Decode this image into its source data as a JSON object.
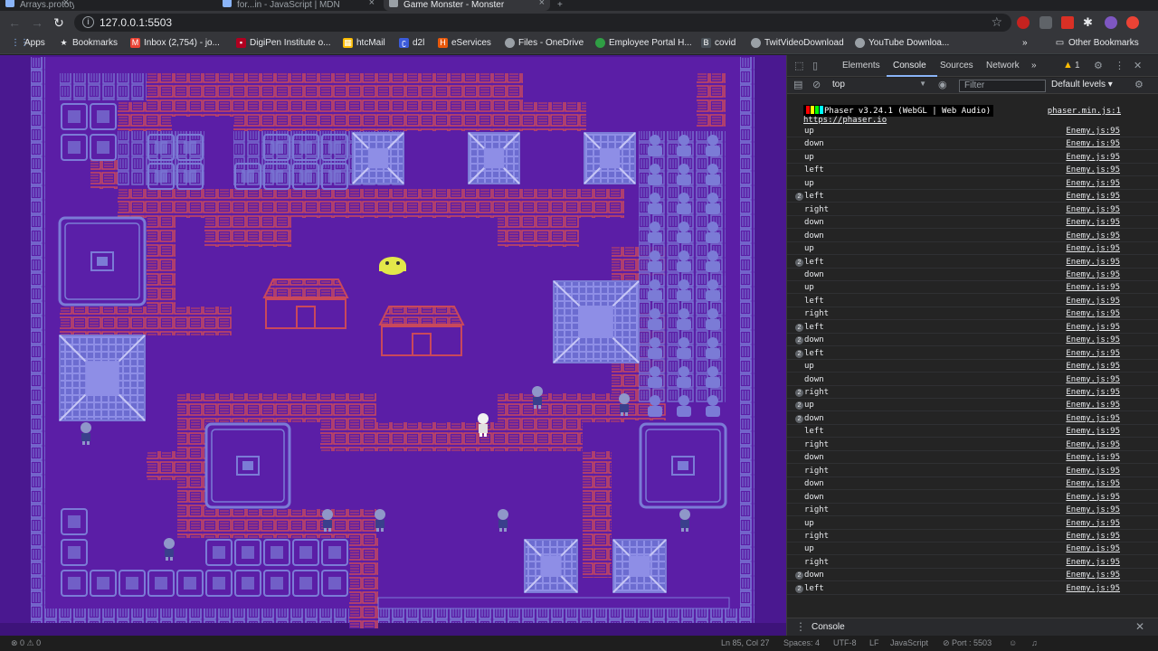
{
  "browser": {
    "tabs": [
      {
        "title": "Arrays.prototype.splice() - JavaScript | MDN"
      },
      {
        "title": "for...in - JavaScript | MDN"
      },
      {
        "title": "Game Monster - Monster"
      }
    ],
    "url": "127.0.0.1:5503",
    "nav": {
      "back": "←",
      "forward": "→",
      "reload": "↻"
    },
    "bookmarks": [
      {
        "label": "Apps",
        "icon": "apps-grid-icon",
        "color": "#8ab4f8"
      },
      {
        "label": "Bookmarks",
        "icon": "star-icon",
        "color": "#e8eaed"
      },
      {
        "label": "Inbox (2,754) - jo...",
        "icon": "gmail-icon",
        "color": "#ea4335"
      },
      {
        "label": "DigiPen Institute o...",
        "icon": "digipen-icon",
        "color": "#b00020"
      },
      {
        "label": "htcMail",
        "icon": "grid-icon",
        "color": "#fbbc04"
      },
      {
        "label": "d2l",
        "icon": "d2l-icon",
        "color": "#3b5bdb"
      },
      {
        "label": "eServices",
        "icon": "eservices-icon",
        "color": "#e8590c"
      },
      {
        "label": "Files - OneDrive",
        "icon": "onedrive-icon",
        "color": "#9aa0a6"
      },
      {
        "label": "Employee Portal H...",
        "icon": "portal-icon",
        "color": "#2f9e44"
      },
      {
        "label": "covid",
        "icon": "doc-icon",
        "color": "#495057"
      },
      {
        "label": "TwitVideoDownload",
        "icon": "globe-icon",
        "color": "#9aa0a6"
      },
      {
        "label": "YouTube Downloa...",
        "icon": "globe-icon",
        "color": "#9aa0a6"
      }
    ],
    "more_bookmarks": "»",
    "other_bookmarks": "Other Bookmarks"
  },
  "devtools": {
    "tabs": [
      "Elements",
      "Console",
      "Sources",
      "Network"
    ],
    "active_tab": "Console",
    "more_tabs": "»",
    "warning_count": "1",
    "context": "top",
    "filter_placeholder": "Filter",
    "levels": "Default levels ▾",
    "phaser_banner": "Phaser v3.24.1 (WebGL | Web Audio)",
    "phaser_url": "https://phaser.io",
    "phaser_source": "phaser.min.js:1",
    "logs": [
      {
        "msg": "up",
        "count": "",
        "src": "Enemy.js:95"
      },
      {
        "msg": "down",
        "count": "",
        "src": "Enemy.js:95"
      },
      {
        "msg": "up",
        "count": "",
        "src": "Enemy.js:95"
      },
      {
        "msg": "left",
        "count": "",
        "src": "Enemy.js:95"
      },
      {
        "msg": "up",
        "count": "",
        "src": "Enemy.js:95"
      },
      {
        "msg": "left",
        "count": "2",
        "src": "Enemy.js:95"
      },
      {
        "msg": "right",
        "count": "",
        "src": "Enemy.js:95"
      },
      {
        "msg": "down",
        "count": "",
        "src": "Enemy.js:95"
      },
      {
        "msg": "down",
        "count": "",
        "src": "Enemy.js:95"
      },
      {
        "msg": "up",
        "count": "",
        "src": "Enemy.js:95"
      },
      {
        "msg": "left",
        "count": "2",
        "src": "Enemy.js:95"
      },
      {
        "msg": "down",
        "count": "",
        "src": "Enemy.js:95"
      },
      {
        "msg": "up",
        "count": "",
        "src": "Enemy.js:95"
      },
      {
        "msg": "left",
        "count": "",
        "src": "Enemy.js:95"
      },
      {
        "msg": "right",
        "count": "",
        "src": "Enemy.js:95"
      },
      {
        "msg": "left",
        "count": "2",
        "src": "Enemy.js:95"
      },
      {
        "msg": "down",
        "count": "2",
        "src": "Enemy.js:95"
      },
      {
        "msg": "left",
        "count": "2",
        "src": "Enemy.js:95"
      },
      {
        "msg": "up",
        "count": "",
        "src": "Enemy.js:95"
      },
      {
        "msg": "down",
        "count": "",
        "src": "Enemy.js:95"
      },
      {
        "msg": "right",
        "count": "2",
        "src": "Enemy.js:95"
      },
      {
        "msg": "up",
        "count": "2",
        "src": "Enemy.js:95"
      },
      {
        "msg": "down",
        "count": "2",
        "src": "Enemy.js:95"
      },
      {
        "msg": "left",
        "count": "",
        "src": "Enemy.js:95"
      },
      {
        "msg": "right",
        "count": "",
        "src": "Enemy.js:95"
      },
      {
        "msg": "down",
        "count": "",
        "src": "Enemy.js:95"
      },
      {
        "msg": "right",
        "count": "",
        "src": "Enemy.js:95"
      },
      {
        "msg": "down",
        "count": "",
        "src": "Enemy.js:95"
      },
      {
        "msg": "down",
        "count": "",
        "src": "Enemy.js:95"
      },
      {
        "msg": "right",
        "count": "",
        "src": "Enemy.js:95"
      },
      {
        "msg": "up",
        "count": "",
        "src": "Enemy.js:95"
      },
      {
        "msg": "right",
        "count": "",
        "src": "Enemy.js:95"
      },
      {
        "msg": "up",
        "count": "",
        "src": "Enemy.js:95"
      },
      {
        "msg": "right",
        "count": "",
        "src": "Enemy.js:95"
      },
      {
        "msg": "down",
        "count": "2",
        "src": "Enemy.js:95"
      },
      {
        "msg": "left",
        "count": "2",
        "src": "Enemy.js:95"
      }
    ],
    "prompt": "›",
    "drawer_label": "Console"
  },
  "statusbar": {
    "problems": "⊗ 0 ⚠ 0",
    "position": "Ln 85, Col 27",
    "spaces": "Spaces: 4",
    "encoding": "UTF-8",
    "eol": "LF",
    "language": "JavaScript",
    "port": "⊘ Port : 5503"
  },
  "game": {
    "background": "#6a23b0",
    "floor": "#5b1ea6",
    "wall_blue": "#7b7bd6",
    "wall_red": "#c9485b"
  }
}
